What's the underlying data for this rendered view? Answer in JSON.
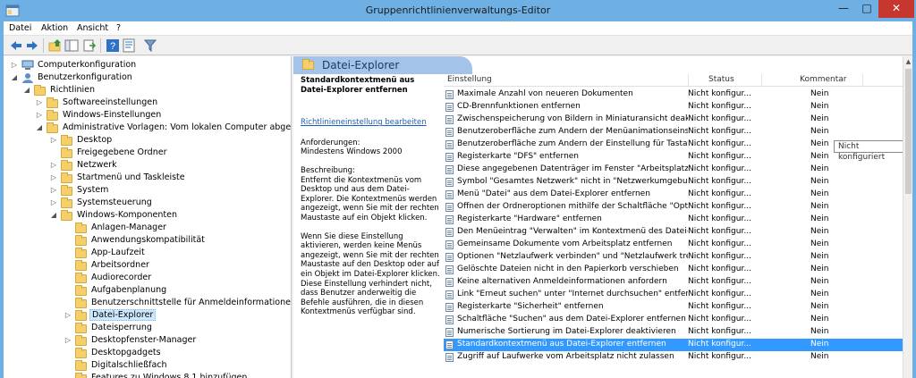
{
  "window": {
    "title": "Gruppenrichtlinienverwaltungs-Editor",
    "minimize": "—",
    "maximize": "□",
    "close": "✕"
  },
  "menu": [
    {
      "label": "Datei"
    },
    {
      "label": "Aktion"
    },
    {
      "label": "Ansicht"
    },
    {
      "label": "?"
    }
  ],
  "toolbar": {
    "icons": [
      "back-arrow-icon",
      "forward-arrow-icon",
      "folder-up-icon",
      "show-hide-tree-icon",
      "export-list-icon",
      "help-icon",
      "properties-icon",
      "filter-icon"
    ]
  },
  "tree": [
    {
      "label": "Computerkonfiguration",
      "level": 1,
      "exp": "▷",
      "icon": "computer"
    },
    {
      "label": "Benutzerkonfiguration",
      "level": 1,
      "exp": "◢",
      "icon": "user"
    },
    {
      "label": "Richtlinien",
      "level": 2,
      "exp": "◢",
      "icon": "folder"
    },
    {
      "label": "Softwareeinstellungen",
      "level": 3,
      "exp": "▷",
      "icon": "folder"
    },
    {
      "label": "Windows-Einstellungen",
      "level": 3,
      "exp": "▷",
      "icon": "folder"
    },
    {
      "label": "Administrative Vorlagen: Vom lokalen Computer abgerufene",
      "level": 3,
      "exp": "◢",
      "icon": "folder"
    },
    {
      "label": "Desktop",
      "level": 4,
      "exp": "▷",
      "icon": "folder"
    },
    {
      "label": "Freigegebene Ordner",
      "level": 4,
      "exp": "",
      "icon": "folder"
    },
    {
      "label": "Netzwerk",
      "level": 4,
      "exp": "▷",
      "icon": "folder"
    },
    {
      "label": "Startmenü und Taskleiste",
      "level": 4,
      "exp": "▷",
      "icon": "folder"
    },
    {
      "label": "System",
      "level": 4,
      "exp": "▷",
      "icon": "folder"
    },
    {
      "label": "Systemsteuerung",
      "level": 4,
      "exp": "▷",
      "icon": "folder"
    },
    {
      "label": "Windows-Komponenten",
      "level": 4,
      "exp": "◢",
      "icon": "folder"
    },
    {
      "label": "Anlagen-Manager",
      "level": 5,
      "exp": "",
      "icon": "folder"
    },
    {
      "label": "Anwendungskompatibilität",
      "level": 5,
      "exp": "",
      "icon": "folder"
    },
    {
      "label": "App-Laufzeit",
      "level": 5,
      "exp": "",
      "icon": "folder"
    },
    {
      "label": "Arbeitsordner",
      "level": 5,
      "exp": "",
      "icon": "folder"
    },
    {
      "label": "Audiorecorder",
      "level": 5,
      "exp": "",
      "icon": "folder"
    },
    {
      "label": "Aufgabenplanung",
      "level": 5,
      "exp": "",
      "icon": "folder"
    },
    {
      "label": "Benutzerschnittstelle für Anmeldeinformationen",
      "level": 5,
      "exp": "",
      "icon": "folder"
    },
    {
      "label": "Datei-Explorer",
      "level": 5,
      "exp": "▷",
      "icon": "folder",
      "selected": true
    },
    {
      "label": "Dateisperrung",
      "level": 5,
      "exp": "",
      "icon": "folder"
    },
    {
      "label": "Desktopfenster-Manager",
      "level": 5,
      "exp": "▷",
      "icon": "folder"
    },
    {
      "label": "Desktopgadgets",
      "level": 5,
      "exp": "",
      "icon": "folder"
    },
    {
      "label": "Digitalschließfach",
      "level": 5,
      "exp": "",
      "icon": "folder"
    },
    {
      "label": "Features zu Windows 8.1 hinzufügen",
      "level": 5,
      "exp": "",
      "icon": "folder"
    }
  ],
  "category": {
    "title": "Datei-Explorer"
  },
  "description": {
    "title": "Standardkontextmenü aus Datei-Explorer entfernen",
    "link": "Richtlinieneinstellung bearbeiten",
    "requirements_label": "Anforderungen:",
    "requirements_value": "Mindestens Windows 2000",
    "description_label": "Beschreibung:",
    "description_text": "Entfernt die Kontextmenüs vom Desktop und aus dem Datei-Explorer. Die Kontextmenüs werden angezeigt, wenn Sie mit der rechten Maustaste auf ein Objekt klicken.",
    "detail_text": "Wenn Sie diese Einstellung aktivieren, werden keine Menüs angezeigt, wenn Sie mit der rechten Maustaste auf den Desktop oder auf ein Objekt im Datei-Explorer klicken. Diese Einstellung verhindert nicht, dass Benutzer anderweitig die Befehle ausführen, die in diesen Kontextmenüs verfügbar sind."
  },
  "table": {
    "columns": [
      "Einstellung",
      "Status",
      "Kommentar"
    ],
    "rows": [
      {
        "setting": "Maximale Anzahl von neueren Dokumenten",
        "status": "Nicht konfigur...",
        "comment": "Nein"
      },
      {
        "setting": "CD-Brennfunktionen entfernen",
        "status": "Nicht konfigur...",
        "comment": "Nein"
      },
      {
        "setting": "Zwischenspeicherung von Bildern in Miniaturansicht deakti...",
        "status": "Nicht konfigur...",
        "comment": "Nein"
      },
      {
        "setting": "Benutzeroberfläche zum Ändern der Menüanimationseinstel...",
        "status": "Nicht konfigur...",
        "comment": "Nein"
      },
      {
        "setting": "Benutzeroberfläche zum Ändern der Einstellung für Tastatur...",
        "status": "Nicht konfigur...",
        "comment": "Nein"
      },
      {
        "setting": "Registerkarte \"DFS\" entfernen",
        "status": "Nicht konfigur...",
        "comment": "Nein"
      },
      {
        "setting": "Diese angegebenen Datenträger im Fenster \"Arbeitsplatz\" au...",
        "status": "Nicht konfigur...",
        "comment": "Nein"
      },
      {
        "setting": "Symbol \"Gesamtes Netzwerk\" nicht in \"Netzwerkumgebung...",
        "status": "Nicht konfigur...",
        "comment": "Nein"
      },
      {
        "setting": "Menü \"Datei\" aus dem Datei-Explorer entfernen",
        "status": "Nicht konfigur...",
        "comment": "Nein"
      },
      {
        "setting": "Öffnen der Ordneroptionen mithilfe der Schaltfläche \"Optio...",
        "status": "Nicht konfigur...",
        "comment": "Nein"
      },
      {
        "setting": "Registerkarte \"Hardware\" entfernen",
        "status": "Nicht konfigur...",
        "comment": "Nein"
      },
      {
        "setting": "Den Menüeintrag \"Verwalten\" im Kontextmenü des Datei-Ex...",
        "status": "Nicht konfigur...",
        "comment": "Nein"
      },
      {
        "setting": "Gemeinsame Dokumente vom Arbeitsplatz entfernen",
        "status": "Nicht konfigur...",
        "comment": "Nein"
      },
      {
        "setting": "Optionen \"Netzlaufwerk verbinden\" und \"Netzlaufwerk tren...",
        "status": "Nicht konfigur...",
        "comment": "Nein"
      },
      {
        "setting": "Gelöschte Dateien nicht in den Papierkorb verschieben",
        "status": "Nicht konfigur...",
        "comment": "Nein"
      },
      {
        "setting": "Keine alternativen Anmeldeinformationen anfordern",
        "status": "Nicht konfigur...",
        "comment": "Nein"
      },
      {
        "setting": "Link \"Erneut suchen\" unter \"Internet durchsuchen\" entfernen",
        "status": "Nicht konfigur...",
        "comment": "Nein"
      },
      {
        "setting": "Registerkarte \"Sicherheit\" entfernen",
        "status": "Nicht konfigur...",
        "comment": "Nein"
      },
      {
        "setting": "Schaltfläche \"Suchen\" aus dem Datei-Explorer entfernen",
        "status": "Nicht konfigur...",
        "comment": "Nein"
      },
      {
        "setting": "Numerische Sortierung im Datei-Explorer deaktivieren",
        "status": "Nicht konfigur...",
        "comment": "Nein"
      },
      {
        "setting": "Standardkontextmenü aus Datei-Explorer entfernen",
        "status": "Nicht konfigur...",
        "comment": "Nein",
        "selected": true
      },
      {
        "setting": "Zugriff auf Laufwerke vom Arbeitsplatz nicht zulassen",
        "status": "Nicht konfigur...",
        "comment": "Nein"
      }
    ],
    "tooltip": "Nicht konfiguriert"
  },
  "colors": {
    "title_bar": "#6fb0e4",
    "selection": "#3399ff",
    "category_header": "#a4c3e8",
    "close_button": "#c7372f"
  }
}
